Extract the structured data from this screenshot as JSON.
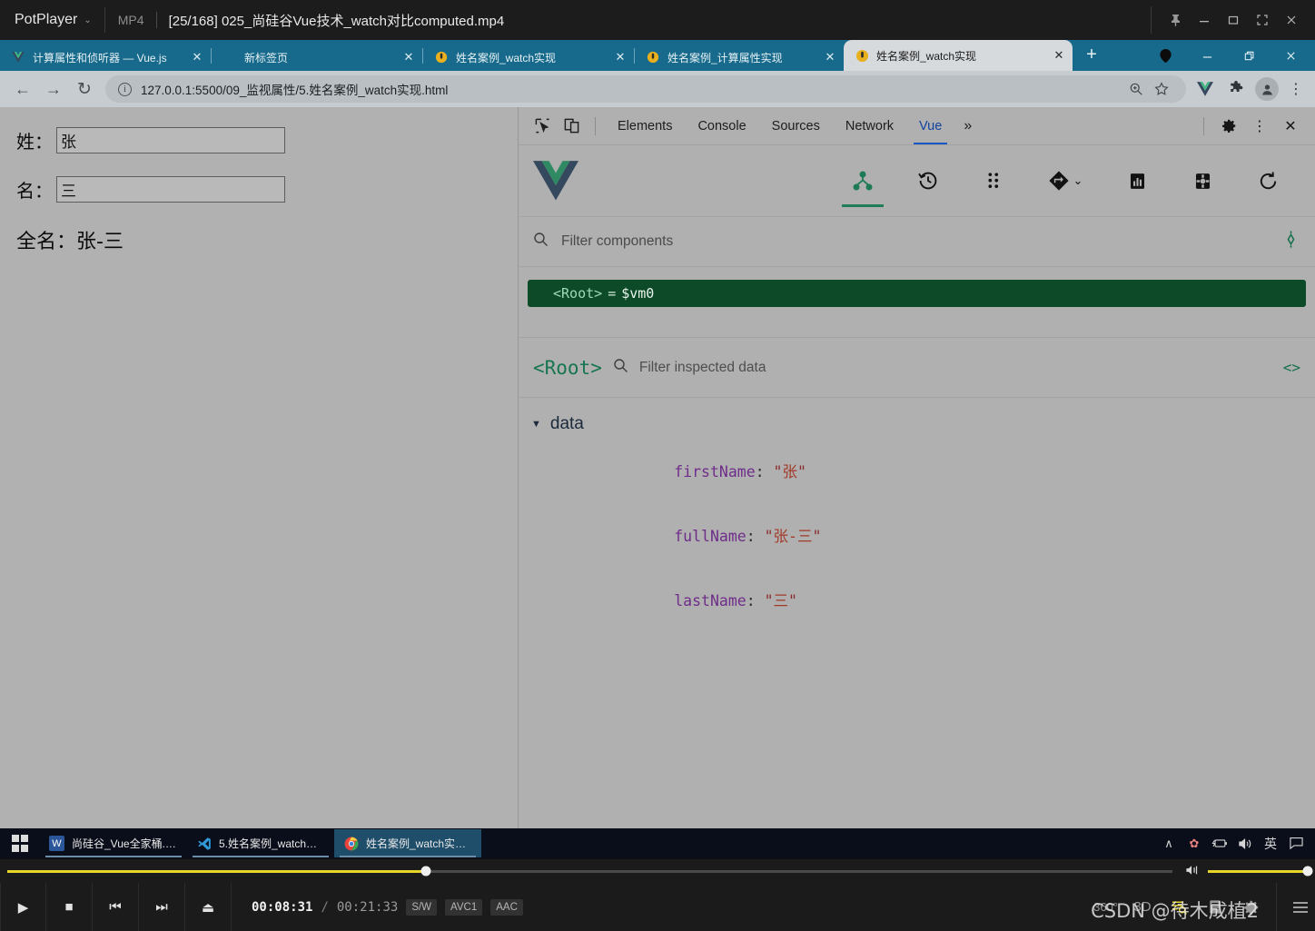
{
  "potplayer": {
    "app_name": "PotPlayer",
    "caret": "⌄",
    "format": "MP4",
    "title": "[25/168] 025_尚硅谷Vue技术_watch对比computed.mp4",
    "window_buttons": [
      {
        "name": "pin-icon",
        "glyph": "📌"
      },
      {
        "name": "minimize-icon",
        "glyph": "—"
      },
      {
        "name": "maximize-icon",
        "glyph": "▭"
      },
      {
        "name": "fullscreen-icon",
        "glyph": "⛶"
      },
      {
        "name": "close-icon",
        "glyph": "✕"
      }
    ]
  },
  "browser": {
    "tabs": [
      {
        "title": "计算属性和侦听器 — Vue.js",
        "favicon": "vue-logo-icon",
        "active": false,
        "close": "✕"
      },
      {
        "title": "新标签页",
        "favicon": "blank-page-icon",
        "active": false,
        "close": "✕"
      },
      {
        "title": "姓名案例_watch实现",
        "favicon": "live-server-icon",
        "active": false,
        "close": "✕"
      },
      {
        "title": "姓名案例_计算属性实现",
        "favicon": "live-server-icon",
        "active": false,
        "close": "✕"
      },
      {
        "title": "姓名案例_watch实现",
        "favicon": "live-server-icon",
        "active": true,
        "close": "✕"
      }
    ],
    "new_tab_label": "+",
    "window_controls": [
      {
        "name": "profile-chip-icon",
        "glyph": "●"
      },
      {
        "name": "minimize-icon",
        "glyph": "—"
      },
      {
        "name": "restore-icon",
        "glyph": "❐"
      },
      {
        "name": "close-icon",
        "glyph": "✕"
      }
    ],
    "nav": {
      "back": "←",
      "forward": "→",
      "reload": "↻",
      "info_icon": "i",
      "url": "127.0.0.1:5500/09_监视属性/5.姓名案例_watch实现.html",
      "zoom_icon": "⌕",
      "bookmark_icon": "☆"
    },
    "extensions": [
      {
        "name": "vue-devtools-extension-icon",
        "glyph": "V"
      },
      {
        "name": "extensions-puzzle-icon",
        "glyph": "❖"
      },
      {
        "name": "profile-avatar-icon",
        "glyph": "●"
      }
    ],
    "menu_icon": "⋮"
  },
  "page": {
    "first_name_label": "姓：",
    "first_name_value": "张",
    "last_name_label": "名：",
    "last_name_value": "三",
    "full_name_text": "全名：张-三"
  },
  "devtools": {
    "inspect_icon": "inspect-element-icon",
    "device_icon": "device-toolbar-icon",
    "tabs": [
      {
        "label": "Elements",
        "active": false
      },
      {
        "label": "Console",
        "active": false
      },
      {
        "label": "Sources",
        "active": false
      },
      {
        "label": "Network",
        "active": false
      },
      {
        "label": "Vue",
        "active": true
      }
    ],
    "more_tabs": "»",
    "settings_icon": "gear-icon",
    "kebab_icon": "⋮",
    "close_icon": "✕"
  },
  "vue_panel": {
    "logo": "vue-logo",
    "nav": [
      {
        "name": "components-tree-icon",
        "active": true
      },
      {
        "name": "timeline-history-icon",
        "active": false
      },
      {
        "name": "vuex-state-icon",
        "active": false
      },
      {
        "name": "routes-icon",
        "active": false,
        "caret": "⌄"
      },
      {
        "name": "performance-icon",
        "active": false
      },
      {
        "name": "settings-gear-icon",
        "active": false
      },
      {
        "name": "refresh-icon",
        "active": false
      }
    ],
    "filter_placeholder": "Filter components",
    "select_component_icon": "select-component-icon",
    "tree": [
      {
        "tag": "<Root>",
        "eq": "=",
        "ref": "$vm0",
        "selected": true
      }
    ],
    "inspector": {
      "component_name": "<Root>",
      "search_icon": "search-icon",
      "filter_placeholder": "Filter inspected data",
      "open_in_editor_icon": "<>",
      "section_label": "data",
      "section_expanded": true,
      "entries": [
        {
          "key": "firstName",
          "value": "张"
        },
        {
          "key": "fullName",
          "value": "张-三"
        },
        {
          "key": "lastName",
          "value": "三"
        }
      ]
    }
  },
  "taskbar": {
    "start_icon": "windows-start-icon",
    "items": [
      {
        "label": "尚硅谷_Vue全家桶.d...",
        "icon": "word-icon",
        "icon_glyph": "W",
        "icon_color": "#2b579a",
        "active": false
      },
      {
        "label": "5.姓名案例_watch实...",
        "icon": "vscode-icon",
        "icon_glyph": "⬜",
        "icon_color": "#1e6fba",
        "active": false
      },
      {
        "label": "姓名案例_watch实现 ...",
        "icon": "chrome-icon",
        "icon_glyph": "●",
        "icon_color": "#e8453c",
        "active": true
      }
    ],
    "tray": [
      {
        "name": "show-hidden-icons-icon",
        "glyph": "∧"
      },
      {
        "name": "flower-app-icon",
        "glyph": "✿"
      },
      {
        "name": "battery-charging-icon",
        "glyph": "⌸"
      },
      {
        "name": "volume-icon",
        "glyph": "🔊"
      },
      {
        "name": "ime-language-icon",
        "glyph": "英"
      },
      {
        "name": "action-center-icon",
        "glyph": "⬜"
      }
    ]
  },
  "player_controls": {
    "seek_percent": 35.9,
    "volume_percent": 100,
    "buttons": [
      {
        "name": "play-button",
        "glyph": "▶"
      },
      {
        "name": "stop-button",
        "glyph": "■"
      },
      {
        "name": "previous-button",
        "glyph": "⏮"
      },
      {
        "name": "next-button",
        "glyph": "⏭"
      },
      {
        "name": "eject-button",
        "glyph": "⏏"
      }
    ],
    "current_time": "00:08:31",
    "separator": "/",
    "total_time": "00:21:33",
    "badges": [
      "S/W",
      "AVC1",
      "AAC"
    ],
    "right_icons": [
      {
        "name": "360-video-icon",
        "label": "360°"
      },
      {
        "name": "3d-video-icon",
        "label": "3D"
      },
      {
        "name": "playlist-search-icon",
        "label": "☰"
      },
      {
        "name": "bookmark-list-icon",
        "label": "▤"
      },
      {
        "name": "preferences-gear-icon",
        "label": "⚙"
      },
      {
        "name": "menu-list-icon",
        "label": "☰"
      }
    ],
    "watermark": "CSDN @待木成植2"
  },
  "colors": {
    "chrome_tabstrip": "#176a8b",
    "vue_green": "#1f7d57",
    "devtools_accent": "#1a56c4",
    "player_yellow": "#e8d52a"
  }
}
